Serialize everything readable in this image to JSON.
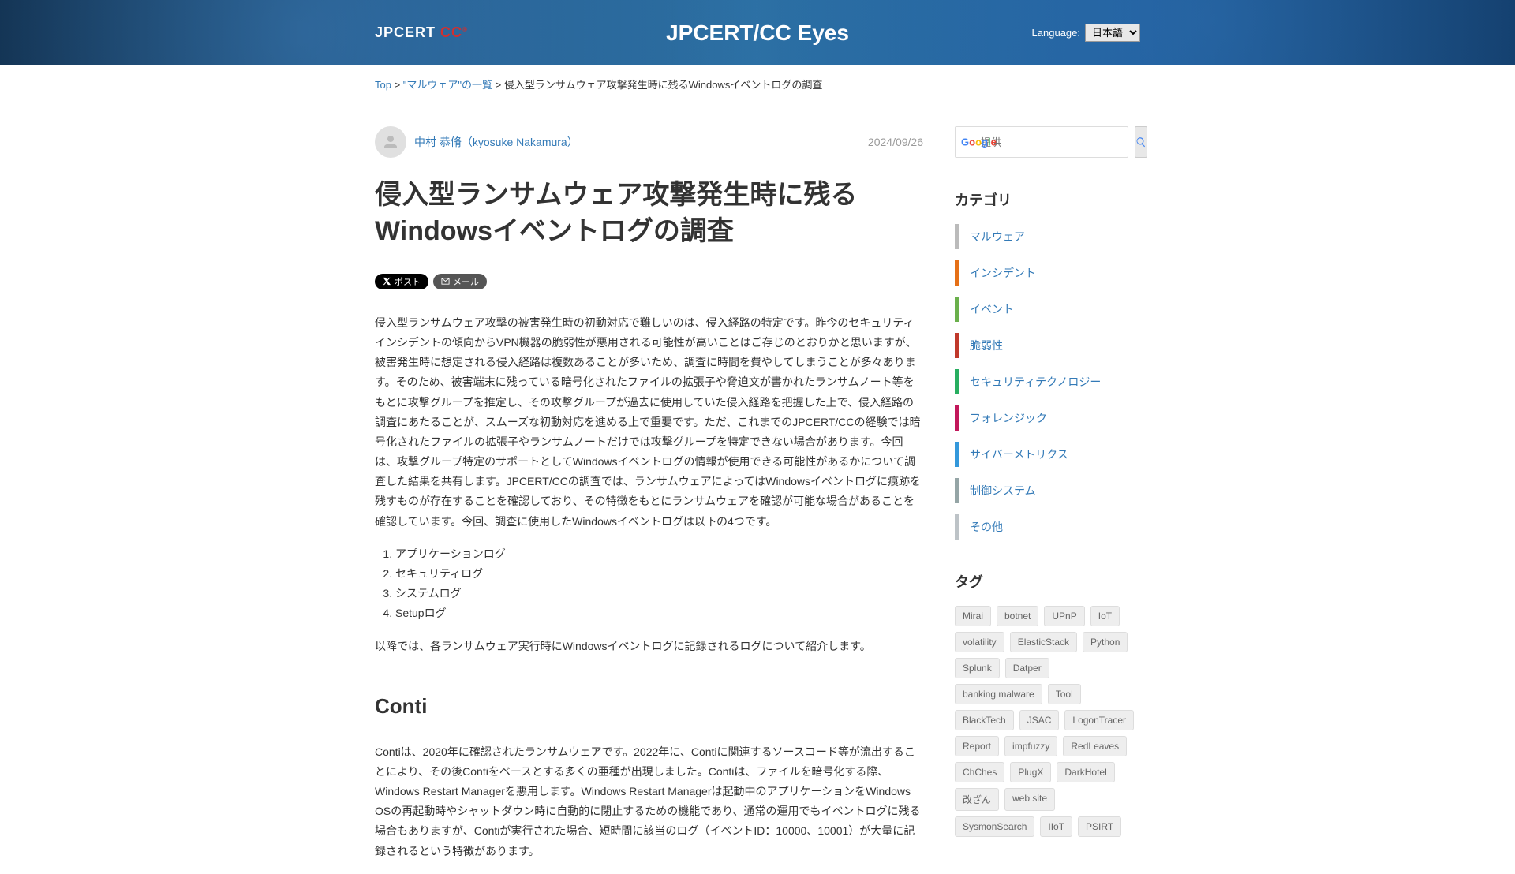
{
  "header": {
    "logo_prefix": "JPCERT ",
    "logo_cc": "CC",
    "site_title": "JPCERT/CC Eyes",
    "language_label": "Language:",
    "language_selected": "日本語"
  },
  "breadcrumb": {
    "top": "Top",
    "sep1": " > ",
    "category": "\"マルウェア\"の一覧",
    "sep2": " > ",
    "current": "侵入型ランサムウェア攻撃発生時に残るWindowsイベントログの調査"
  },
  "article": {
    "author": "中村 恭脩（kyosuke Nakamura）",
    "date": "2024/09/26",
    "title": "侵入型ランサムウェア攻撃発生時に残るWindowsイベントログの調査",
    "share": {
      "post": "ポスト",
      "mail": "メール"
    },
    "para1": "侵入型ランサムウェア攻撃の被害発生時の初動対応で難しいのは、侵入経路の特定です。昨今のセキュリティインシデントの傾向からVPN機器の脆弱性が悪用される可能性が高いことはご存じのとおりかと思いますが、被害発生時に想定される侵入経路は複数あることが多いため、調査に時間を費やしてしまうことが多々あります。そのため、被害端末に残っている暗号化されたファイルの拡張子や脅迫文が書かれたランサムノート等をもとに攻撃グループを推定し、その攻撃グループが過去に使用していた侵入経路を把握した上で、侵入経路の調査にあたることが、スムーズな初動対応を進める上で重要です。ただ、これまでのJPCERT/CCの経験では暗号化されたファイルの拡張子やランサムノートだけでは攻撃グループを特定できない場合があります。今回は、攻撃グループ特定のサポートとしてWindowsイベントログの情報が使用できる可能性があるかについて調査した結果を共有します。JPCERT/CCの調査では、ランサムウェアによってはWindowsイベントログに痕跡を残すものが存在することを確認しており、その特徴をもとにランサムウェアを確認が可能な場合があることを確認しています。今回、調査に使用したWindowsイベントログは以下の4つです。",
    "logs": [
      "アプリケーションログ",
      "セキュリティログ",
      "システムログ",
      "Setupログ"
    ],
    "para2": "以降では、各ランサムウェア実行時にWindowsイベントログに記録されるログについて紹介します。",
    "h2_conti": "Conti",
    "para3": "Contiは、2020年に確認されたランサムウェアです。2022年に、Contiに関連するソースコード等が流出することにより、その後Contiをベースとする多くの亜種が出現しました。Contiは、ファイルを暗号化する際、Windows Restart Managerを悪用します。Windows Restart Managerは起動中のアプリケーションをWindows OSの再起動時やシャットダウン時に自動的に閉止するための機能であり、通常の運用でもイベントログに残る場合もありますが、Contiが実行された場合、短時間に該当のログ（イベントID：10000、10001）が大量に記録されるという特徴があります。"
  },
  "search": {
    "placeholder": "提供"
  },
  "categories": {
    "heading": "カテゴリ",
    "items": [
      {
        "label": "マルウェア",
        "color": "#bbbbbb"
      },
      {
        "label": "インシデント",
        "color": "#e57017"
      },
      {
        "label": "イベント",
        "color": "#6ab04c"
      },
      {
        "label": "脆弱性",
        "color": "#c0392b"
      },
      {
        "label": "セキュリティテクノロジー",
        "color": "#27ae60"
      },
      {
        "label": "フォレンジック",
        "color": "#c2185b"
      },
      {
        "label": "サイバーメトリクス",
        "color": "#3498db"
      },
      {
        "label": "制御システム",
        "color": "#95a5a6"
      },
      {
        "label": "その他",
        "color": "#bdc3c7"
      }
    ]
  },
  "tags": {
    "heading": "タグ",
    "items": [
      "Mirai",
      "botnet",
      "UPnP",
      "IoT",
      "volatility",
      "ElasticStack",
      "Python",
      "Splunk",
      "Datper",
      "banking malware",
      "Tool",
      "BlackTech",
      "JSAC",
      "LogonTracer",
      "Report",
      "impfuzzy",
      "RedLeaves",
      "ChChes",
      "PlugX",
      "DarkHotel",
      "改ざん",
      "web site",
      "SysmonSearch",
      "IIoT",
      "PSIRT"
    ]
  }
}
